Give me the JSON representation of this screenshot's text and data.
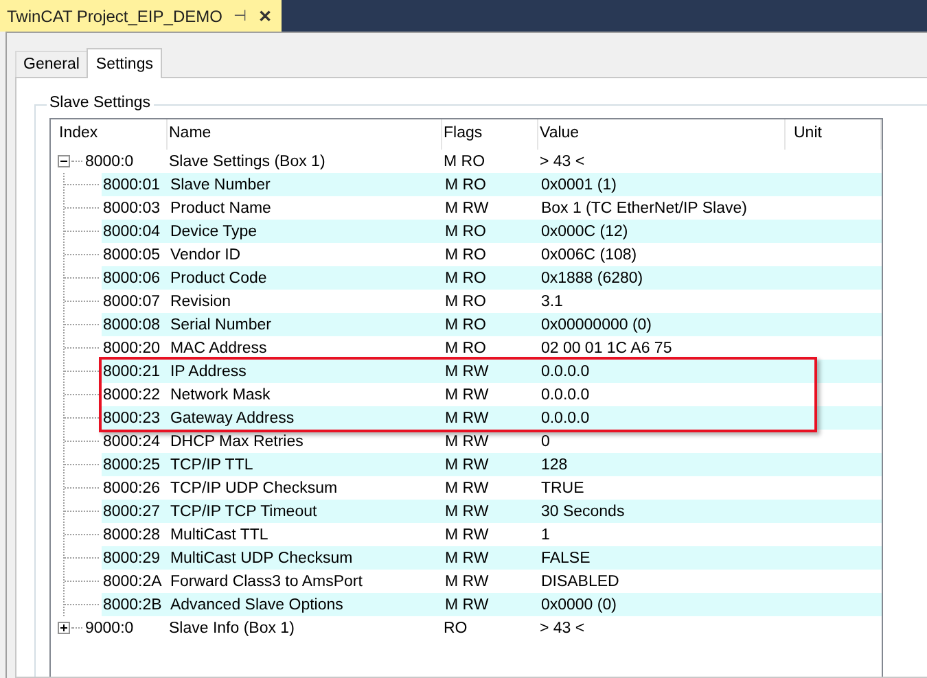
{
  "document_tab": {
    "title": "TwinCAT Project_EIP_DEMO",
    "pin": "⊣",
    "close": "✕"
  },
  "tabs": [
    {
      "label": "General",
      "selected": false
    },
    {
      "label": "Settings",
      "selected": true
    }
  ],
  "group": {
    "title": "Slave Settings"
  },
  "table": {
    "columns": [
      "Index",
      "Name",
      "Flags",
      "Value",
      "Unit"
    ],
    "rows": [
      {
        "index": "8000:0",
        "name": "Slave Settings (Box 1)",
        "flags": "M RO",
        "value": "> 43 <",
        "expanded": true,
        "children": [
          {
            "index": "8000:01",
            "name": "Slave Number",
            "flags": "M RO",
            "value": "0x0001 (1)",
            "highlighted": false
          },
          {
            "index": "8000:03",
            "name": "Product Name",
            "flags": "M RW",
            "value": "Box 1 (TC EtherNet/IP Slave)",
            "highlighted": false
          },
          {
            "index": "8000:04",
            "name": "Device Type",
            "flags": "M RO",
            "value": "0x000C (12)",
            "highlighted": false
          },
          {
            "index": "8000:05",
            "name": "Vendor ID",
            "flags": "M RO",
            "value": "0x006C (108)",
            "highlighted": false
          },
          {
            "index": "8000:06",
            "name": "Product Code",
            "flags": "M RO",
            "value": "0x1888 (6280)",
            "highlighted": false
          },
          {
            "index": "8000:07",
            "name": "Revision",
            "flags": "M RO",
            "value": "3.1",
            "highlighted": false
          },
          {
            "index": "8000:08",
            "name": "Serial Number",
            "flags": "M RO",
            "value": "0x00000000 (0)",
            "highlighted": false
          },
          {
            "index": "8000:20",
            "name": "MAC Address",
            "flags": "M RO",
            "value": "02 00 01 1C A6 75",
            "highlighted": false
          },
          {
            "index": "8000:21",
            "name": "IP Address",
            "flags": "M RW",
            "value": "0.0.0.0",
            "highlighted": true
          },
          {
            "index": "8000:22",
            "name": "Network Mask",
            "flags": "M RW",
            "value": "0.0.0.0",
            "highlighted": true
          },
          {
            "index": "8000:23",
            "name": "Gateway Address",
            "flags": "M RW",
            "value": "0.0.0.0",
            "highlighted": true
          },
          {
            "index": "8000:24",
            "name": "DHCP Max Retries",
            "flags": "M RW",
            "value": "0",
            "highlighted": false
          },
          {
            "index": "8000:25",
            "name": "TCP/IP TTL",
            "flags": "M RW",
            "value": "128",
            "highlighted": false
          },
          {
            "index": "8000:26",
            "name": "TCP/IP UDP Checksum",
            "flags": "M RW",
            "value": "TRUE",
            "highlighted": false
          },
          {
            "index": "8000:27",
            "name": "TCP/IP TCP Timeout",
            "flags": "M RW",
            "value": "30 Seconds",
            "highlighted": false
          },
          {
            "index": "8000:28",
            "name": "MultiCast TTL",
            "flags": "M RW",
            "value": "1",
            "highlighted": false
          },
          {
            "index": "8000:29",
            "name": "MultiCast UDP Checksum",
            "flags": "M RW",
            "value": "FALSE",
            "highlighted": false
          },
          {
            "index": "8000:2A",
            "name": "Forward Class3 to AmsPort",
            "flags": "M RW",
            "value": "DISABLED",
            "highlighted": false
          },
          {
            "index": "8000:2B",
            "name": "Advanced Slave Options",
            "flags": "M RW",
            "value": "0x0000 (0)",
            "highlighted": false
          }
        ]
      },
      {
        "index": "9000:0",
        "name": "Slave Info (Box 1)",
        "flags": "RO",
        "value": "> 43 <",
        "expanded": false
      }
    ]
  }
}
